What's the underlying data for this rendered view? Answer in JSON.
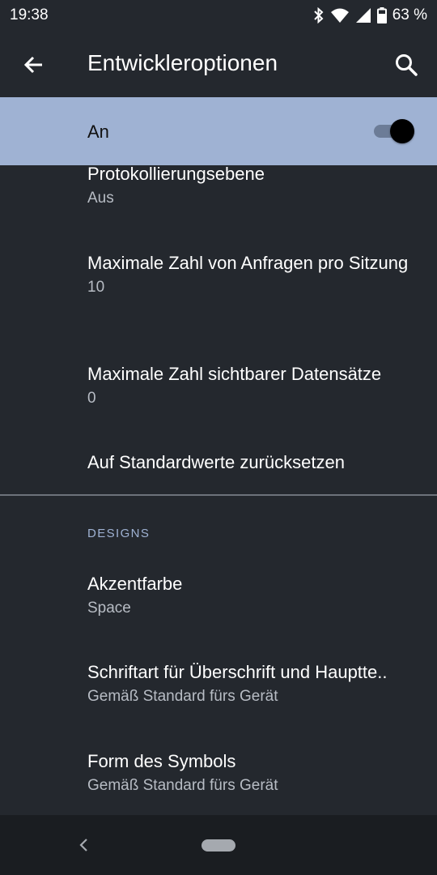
{
  "status_bar": {
    "time": "19:38",
    "battery_percent": "63 %",
    "icons": [
      "bluetooth-icon",
      "wifi-icon",
      "signal-icon",
      "battery-icon"
    ]
  },
  "app_bar": {
    "title": "Entwickleroptionen",
    "back_icon": "arrow-back-icon",
    "search_icon": "search-icon"
  },
  "master_switch": {
    "label": "An",
    "checked": true,
    "background": "#9fb2d3"
  },
  "items": [
    {
      "title": "Protokollierungsebene",
      "summary": "Aus"
    },
    {
      "title": "Maximale Zahl von Anfragen pro Sitzung",
      "summary": "10"
    },
    {
      "title": "Maximale Zahl sichtbarer Datensätze",
      "summary": "0"
    },
    {
      "title": "Auf Standardwerte zurücksetzen"
    }
  ],
  "designs": {
    "header": "DESIGNS",
    "items": [
      {
        "title": "Akzentfarbe",
        "summary": "Space"
      },
      {
        "title": "Schriftart für Überschrift und Hauptte..",
        "summary": "Gemäß Standard fürs Gerät"
      },
      {
        "title": "Form des Symbols",
        "summary": "Gemäß Standard fürs Gerät"
      }
    ]
  },
  "colors": {
    "background": "#24282e",
    "accent": "#9fb2d3",
    "secondary_text": "#b7bcc4"
  }
}
